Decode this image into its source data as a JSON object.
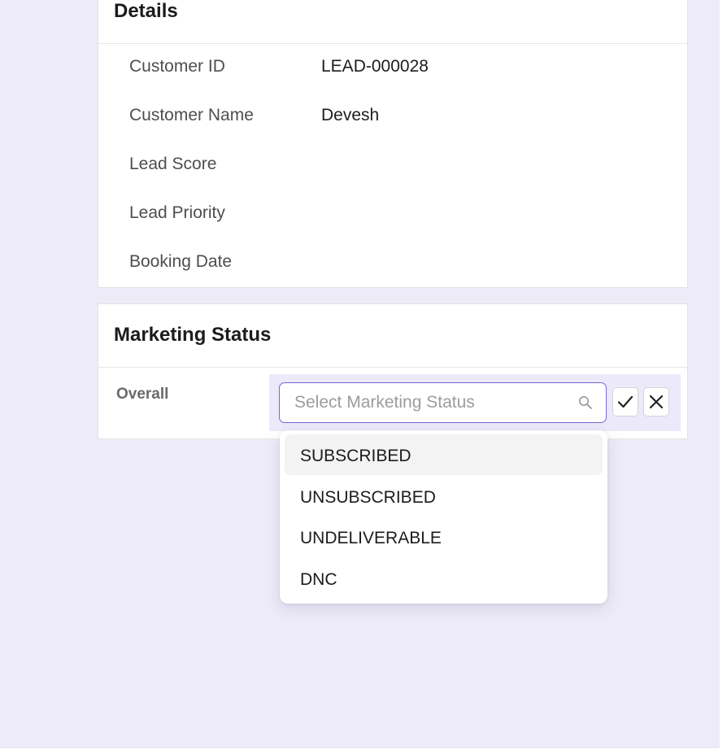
{
  "details": {
    "title": "Details",
    "fields": [
      {
        "label": "Customer ID",
        "value": "LEAD-000028"
      },
      {
        "label": "Customer Name",
        "value": "Devesh"
      },
      {
        "label": "Lead Score",
        "value": ""
      },
      {
        "label": "Lead Priority",
        "value": ""
      },
      {
        "label": "Booking Date",
        "value": ""
      }
    ]
  },
  "marketing": {
    "title": "Marketing Status",
    "overall_label": "Overall",
    "select_placeholder": "Select Marketing Status",
    "options": [
      "SUBSCRIBED",
      "UNSUBSCRIBED",
      "UNDELIVERABLE",
      "DNC"
    ],
    "highlighted_option": "SUBSCRIBED"
  },
  "icons": {
    "search": "search-icon",
    "confirm": "checkmark-icon",
    "cancel": "close-icon"
  },
  "colors": {
    "page_background": "#eeebf8",
    "focus_border": "#7e62d6",
    "edit_panel_background": "#ece9fa",
    "option_highlight": "#f3f3f3"
  }
}
